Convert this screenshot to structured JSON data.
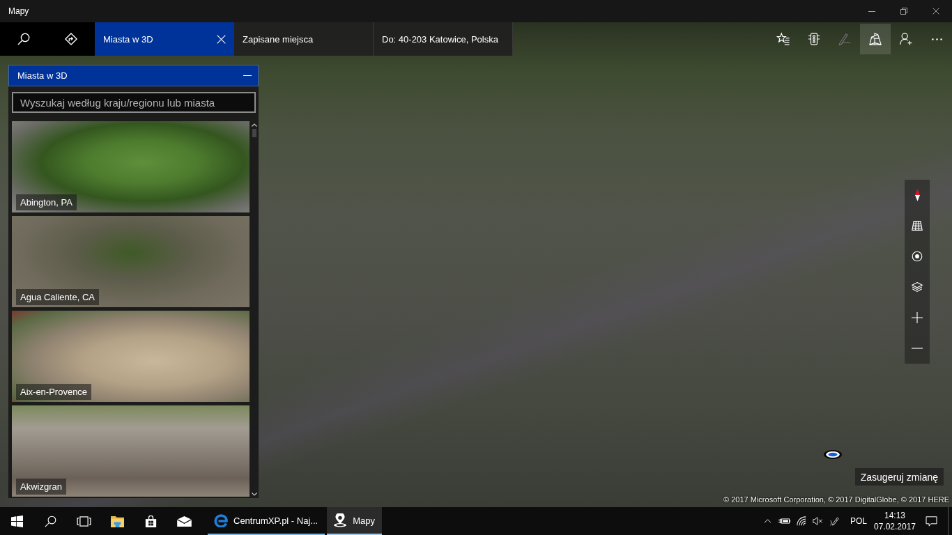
{
  "window": {
    "title": "Mapy",
    "controls": [
      {
        "kind": "minimize"
      },
      {
        "kind": "restore"
      },
      {
        "kind": "close"
      }
    ]
  },
  "toolbar": {
    "buttons": [
      {
        "kind": "search"
      },
      {
        "kind": "directions"
      }
    ],
    "tabs": [
      {
        "label": "Miasta w 3D",
        "selected": true
      },
      {
        "label": "Zapisane miejsca",
        "selected": false
      },
      {
        "label": "Do: 40-203 Katowice, Polska",
        "selected": false
      }
    ],
    "actions": [
      {
        "kind": "favorites",
        "selected": false,
        "disabled": false
      },
      {
        "kind": "traffic",
        "selected": false,
        "disabled": false
      },
      {
        "kind": "ink",
        "selected": false,
        "disabled": true
      },
      {
        "kind": "cities_3d",
        "selected": true,
        "disabled": false
      },
      {
        "kind": "sign_in",
        "selected": false,
        "disabled": false
      },
      {
        "kind": "more",
        "selected": false,
        "disabled": false
      }
    ]
  },
  "panel": {
    "title": "Miasta w 3D",
    "search": {
      "placeholder": "Wyszukaj według kraju/regionu lub miasta"
    },
    "cities": [
      {
        "name": "Abington, PA"
      },
      {
        "name": "Agua Caliente, CA"
      },
      {
        "name": "Aix-en-Provence"
      },
      {
        "name": "Akwizgran"
      }
    ]
  },
  "map": {
    "controls": [
      {
        "kind": "compass"
      },
      {
        "kind": "tilt"
      },
      {
        "kind": "locate"
      },
      {
        "kind": "layers"
      },
      {
        "kind": "zoom_in"
      },
      {
        "kind": "zoom_out"
      }
    ],
    "suggest_button": "Zasugeruj zmianę",
    "copyright": "© 2017 Microsoft Corporation, © 2017 DigitalGlobe, © 2017 HERE"
  },
  "taskbar": {
    "pinned": [
      {
        "kind": "start"
      },
      {
        "kind": "search"
      },
      {
        "kind": "task_view"
      },
      {
        "kind": "explorer"
      },
      {
        "kind": "store"
      },
      {
        "kind": "mail"
      }
    ],
    "apps": [
      {
        "kind": "browser",
        "label": "CentrumXP.pl - Naj...",
        "selected": false
      },
      {
        "kind": "maps",
        "label": "Mapy",
        "selected": true
      }
    ],
    "tray": [
      {
        "kind": "chevron"
      },
      {
        "kind": "power"
      },
      {
        "kind": "wifi"
      },
      {
        "kind": "volume_muted"
      },
      {
        "kind": "pen"
      }
    ],
    "language": "POL",
    "time": "14:13",
    "date": "07.02.2017"
  }
}
